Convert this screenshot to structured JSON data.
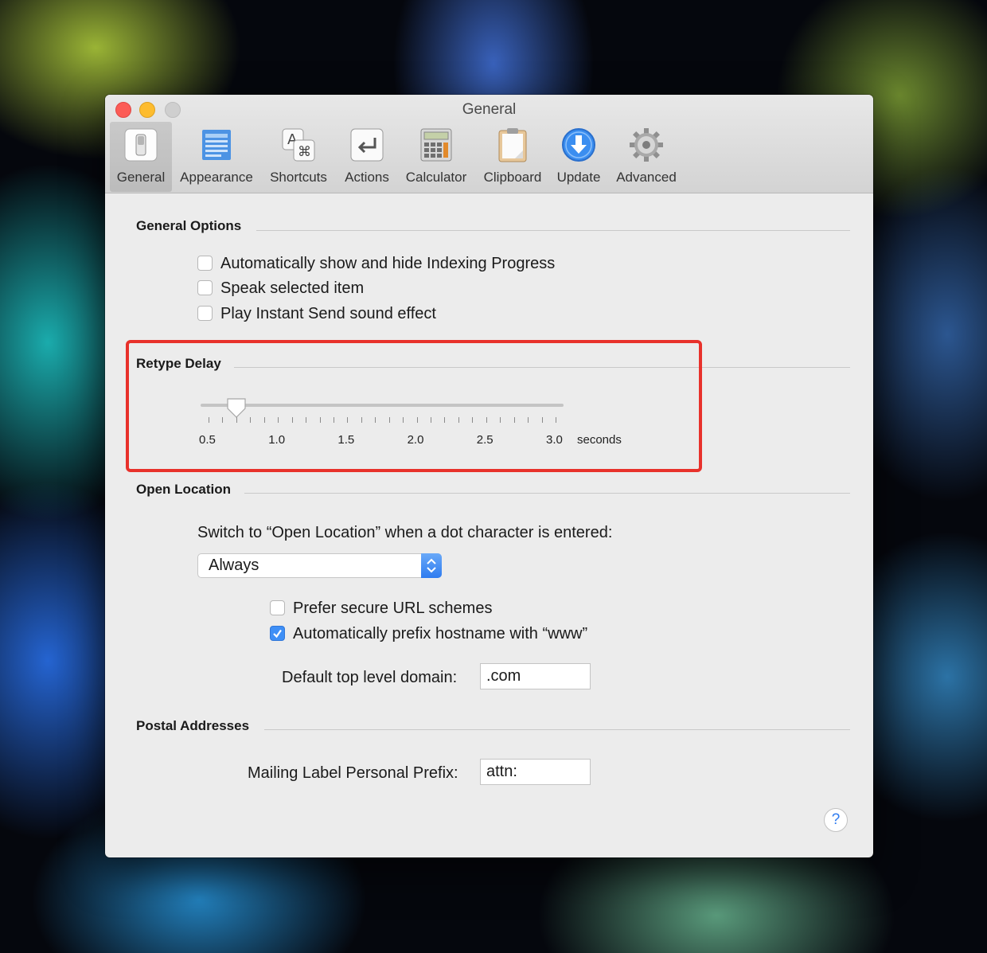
{
  "window": {
    "title": "General"
  },
  "toolbar": {
    "items": [
      {
        "label": "General",
        "icon": "general-switch-icon",
        "selected": true
      },
      {
        "label": "Appearance",
        "icon": "appearance-icon"
      },
      {
        "label": "Shortcuts",
        "icon": "shortcuts-icon"
      },
      {
        "label": "Actions",
        "icon": "actions-icon"
      },
      {
        "label": "Calculator",
        "icon": "calculator-icon"
      },
      {
        "label": "Clipboard",
        "icon": "clipboard-icon"
      },
      {
        "label": "Update",
        "icon": "update-icon"
      },
      {
        "label": "Advanced",
        "icon": "gear-icon"
      }
    ]
  },
  "general_options": {
    "title": "General Options",
    "checkboxes": [
      {
        "label": "Automatically show and hide Indexing Progress",
        "checked": false
      },
      {
        "label": "Speak selected item",
        "checked": false
      },
      {
        "label": "Play Instant Send sound effect",
        "checked": false
      }
    ]
  },
  "retype_delay": {
    "title": "Retype Delay",
    "tick_labels": [
      "0.5",
      "1.0",
      "1.5",
      "2.0",
      "2.5",
      "3.0"
    ],
    "unit": "seconds",
    "value": 0.7,
    "min": 0.5,
    "max": 3.0
  },
  "open_location": {
    "title": "Open Location",
    "prompt": "Switch to “Open Location” when a dot character is entered:",
    "popup_value": "Always",
    "checkboxes": [
      {
        "label": "Prefer secure URL schemes",
        "checked": false
      },
      {
        "label": "Automatically prefix hostname with “www”",
        "checked": true
      }
    ],
    "domain_label": "Default top level domain:",
    "domain_value": ".com"
  },
  "postal_addresses": {
    "title": "Postal Addresses",
    "prefix_label": "Mailing Label Personal Prefix:",
    "prefix_value": "attn:"
  },
  "help_label": "?",
  "colors": {
    "highlight": "#e8312b",
    "accent": "#3e8ff6"
  }
}
